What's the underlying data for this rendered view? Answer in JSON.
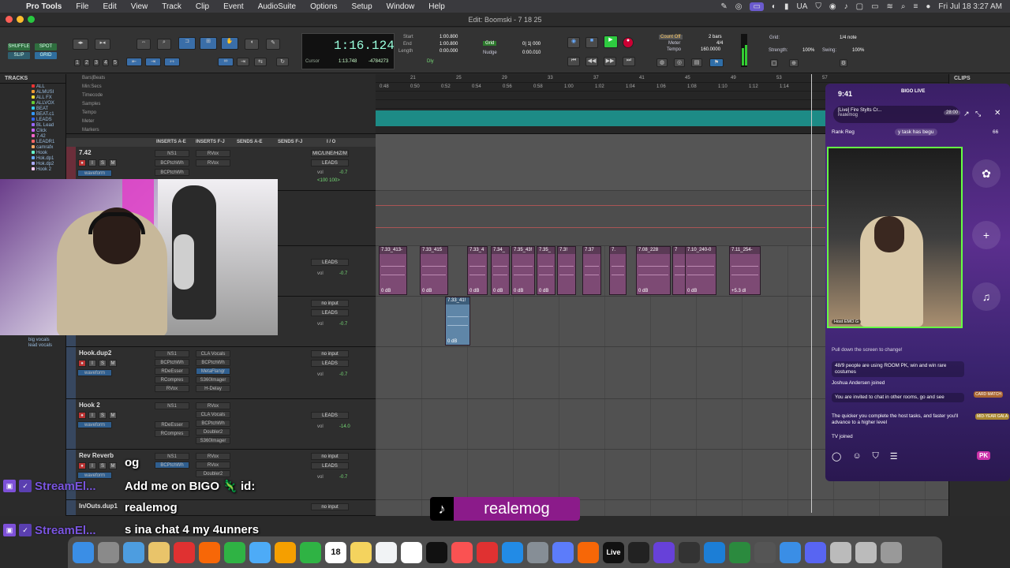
{
  "menubar": {
    "items": [
      "Pro Tools",
      "File",
      "Edit",
      "View",
      "Track",
      "Clip",
      "Event",
      "AudioSuite",
      "Options",
      "Setup",
      "Window",
      "Help"
    ],
    "input_source": "UA",
    "datetime": "Fri Jul 18  3:27 AM"
  },
  "window": {
    "title": "Edit: Boomski - 7 18 25"
  },
  "toolbar": {
    "modes": [
      "SHUFFLE",
      "SPOT",
      "SLIP",
      "GRID"
    ],
    "zoom_presets": [
      "1",
      "2",
      "3",
      "4",
      "5"
    ],
    "counter_main": "1:16.124",
    "counter_labels": {
      "cursor": "Cursor",
      "cursor_value": "1:13.748",
      "sample": "-4784273"
    },
    "start_label": "Start",
    "start": "1:00.800",
    "end_label": "End",
    "end": "1:00.800",
    "length_label": "Length",
    "length": "0:00.000",
    "grid_label": "Grid",
    "grid_value": "0| 1| 000",
    "nudge_label": "Nudge",
    "nudge_value": "0:00.010",
    "count_off": "Count Off",
    "count_off_bars": "2 bars",
    "meter_label": "Meter",
    "meter": "4/4",
    "tempo_label": "Tempo",
    "tempo": "160.0000",
    "grid2_label": "Grid:",
    "grid2_value": "1/4 note",
    "strength_label": "Strength:",
    "strength": "100%",
    "swing_label": "Swing:",
    "swing": "100%"
  },
  "tracks_pane": {
    "title": "TRACKS",
    "items": [
      "ALL",
      "ALMUSI",
      "ALL FX",
      "ALLVOX",
      "BEAT",
      "BEAT.c1",
      "LEADS",
      "BL Lead",
      "Click",
      "7.42",
      "LEADR1",
      "camrafx",
      "Hook",
      "Hok.dp1",
      "Hok.dp2",
      "Hook 2"
    ],
    "extra": [
      "big vocals",
      "lead vocals"
    ]
  },
  "rulers": {
    "labels": [
      "Bars|Beats",
      "Min:Secs",
      "Timecode",
      "Samples",
      "Tempo",
      "Meter",
      "Markers"
    ],
    "bar_ticks": [
      "21",
      "25",
      "29",
      "33",
      "37",
      "41",
      "45",
      "49",
      "53",
      "57"
    ],
    "min_ticks": [
      "0:48",
      "0:50",
      "0:52",
      "0:54",
      "0:56",
      "0:58",
      "1:00",
      "1:02",
      "1:04",
      "1:06",
      "1:08",
      "1:10",
      "1:12",
      "1:14"
    ]
  },
  "mix_header": {
    "inserts_ae": "INSERTS A-E",
    "inserts_fj": "INSERTS F-J",
    "sends_ae": "SENDS A-E",
    "sends_fj": "SENDS F-J",
    "io": "I / O"
  },
  "mixer_rows": [
    {
      "name": "7.42",
      "mode": "waveform",
      "inserts": [
        "NS1",
        "BCPtchWh",
        "BCPtchWh"
      ],
      "inserts2": [
        "RVox",
        "RVox"
      ],
      "io_in": "MIC/LINE/HiZ/M",
      "io_out": "LEADS",
      "vol": "-0.7",
      "pan": "<100  100>"
    },
    {
      "name": "",
      "mode": "",
      "inserts": [],
      "inserts2": [],
      "io_in": "",
      "io_out": "LEADS",
      "vol": "-0.7",
      "pan": ""
    },
    {
      "name": "",
      "mode": "",
      "inserts": [],
      "inserts2": [],
      "io_in": "no input",
      "io_out": "LEADS",
      "vol": "-0.7",
      "pan": ""
    },
    {
      "name": "Hook.dup2",
      "mode": "waveform",
      "inserts": [
        "NS1",
        "BCPtchWh",
        "RDeEsser",
        "RCompres",
        "RVox"
      ],
      "inserts2": [
        "CLA Vocals",
        "BCPtchWh",
        "MetaFlangr",
        "S360Imager",
        "H-Delay"
      ],
      "io_in": "no input",
      "io_out": "LEADS",
      "vol": "-0.7",
      "pan": ""
    },
    {
      "name": "Hook 2",
      "mode": "waveform",
      "inserts": [
        "NS1",
        "RDeEsser",
        "RCompres"
      ],
      "inserts2": [
        "RVox",
        "CLA Vocals",
        "BCPtchWh",
        "Doubler2",
        "S360Imager"
      ],
      "io_in": "",
      "io_out": "LEADS",
      "vol": "-14.0",
      "pan": ""
    },
    {
      "name": "Rev Reverb",
      "mode": "waveform",
      "inserts": [
        "NS1",
        "BCPtchWh"
      ],
      "inserts2": [
        "RVox",
        "RVox",
        "Doubler2"
      ],
      "io_in": "no input",
      "io_out": "LEADS",
      "vol": "-0.7",
      "pan": ""
    },
    {
      "name": "In/Outs.dup1",
      "mode": "",
      "inserts": [],
      "inserts2": [],
      "io_in": "no input",
      "io_out": "",
      "vol": "",
      "pan": ""
    }
  ],
  "clips": [
    {
      "name": "7.33_413-",
      "gain": "0 dB"
    },
    {
      "name": "7.33_415",
      "gain": "0 dB"
    },
    {
      "name": "7.33_4",
      "gain": "0 dB"
    },
    {
      "name": "7.34_",
      "gain": "0 dB"
    },
    {
      "name": "7.35_43!",
      "gain": "0 dB"
    },
    {
      "name": "7.35_",
      "gain": "0 dB"
    },
    {
      "name": "7.3!",
      "gain": ""
    },
    {
      "name": "7.37",
      "gain": ""
    },
    {
      "name": "7.",
      "gain": ""
    },
    {
      "name": "7.08_228",
      "gain": "0 dB"
    },
    {
      "name": "7",
      "gain": ""
    },
    {
      "name": "7.10_240-0",
      "gain": "0 dB"
    },
    {
      "name": "7.11_254-",
      "gain": "+5.3 dl"
    },
    {
      "name": "7.33_41!",
      "gain": "0 dB"
    }
  ],
  "clips_pane": {
    "title": "CLIPS"
  },
  "phone": {
    "time": "9:41",
    "app": "BIGO LIVE",
    "title": "[Live] Fire Stylts Cr...",
    "user": "realemog",
    "viewers": "28:00",
    "rank": "Rank  Reg",
    "task": "y task has begu",
    "count": "66",
    "host_tag": "Host  EMO G",
    "pull_hint": "Pull down the screen to change!",
    "chat": [
      "48/9 people are using ROOM PK, win and win rare costumes",
      "Joshua Andersen joined",
      "You are invited to chat in other rooms, go and see",
      "The quicker you complete the host tasks, and faster you'll advance to a higher level",
      "TV joined"
    ],
    "badges": [
      "CARD MATCH",
      "MID-YEAR GALA",
      "PK"
    ]
  },
  "overlays": {
    "streamer_label": "StreamEl...",
    "line1_prefix": "og",
    "line2": "Add me on BIGO 🦎 id:",
    "line3": "realemog",
    "line4": "s ina chat 4 my 4unners",
    "tiktok_name": "realemog"
  },
  "dock": {
    "items": [
      "finder",
      "launchpad",
      "preview",
      "chrome",
      "opera",
      "brave",
      "messages",
      "maps",
      "photos",
      "facetime",
      "calendar",
      "notes",
      "reminders",
      "freeform",
      "appletv",
      "music",
      "news",
      "appstore",
      "settings",
      "plugins",
      "fl-studio",
      "ableton",
      "logic",
      "pro-tools",
      "utility",
      "safari",
      "activity",
      "calculator",
      "finder2",
      "discord",
      "music2",
      "music3",
      "trash"
    ],
    "calendar_day": "18",
    "ableton_label": "Live"
  }
}
